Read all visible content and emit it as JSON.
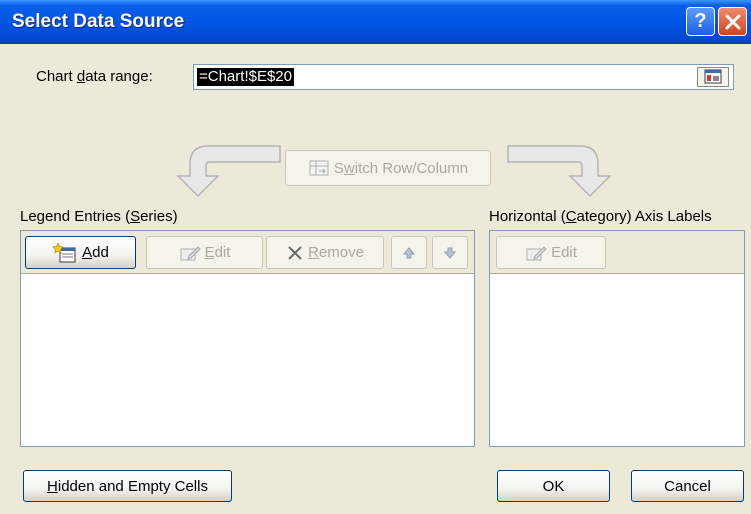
{
  "dialog": {
    "title": "Select Data Source"
  },
  "range": {
    "label_prefix": "Chart ",
    "label_mnemonic": "d",
    "label_suffix": "ata range:",
    "value": "=Chart!$E$20"
  },
  "switch_button": {
    "pre": "S",
    "mnemonic": "w",
    "post": "itch Row/Column"
  },
  "legend": {
    "title_pre": "Legend Entries (",
    "title_mnemonic": "S",
    "title_post": "eries)",
    "add_mnemonic": "A",
    "add_rest": "dd",
    "edit_mnemonic": "E",
    "edit_rest": "dit",
    "remove_mnemonic": "R",
    "remove_rest": "emove"
  },
  "axis": {
    "title_pre": "Horizontal (",
    "title_mnemonic": "C",
    "title_post": "ategory) Axis Labels",
    "edit_label": "Edit"
  },
  "footer": {
    "hidden_mnemonic": "H",
    "hidden_rest": "idden and Empty Cells",
    "ok_label": "OK",
    "cancel_label": "Cancel"
  }
}
